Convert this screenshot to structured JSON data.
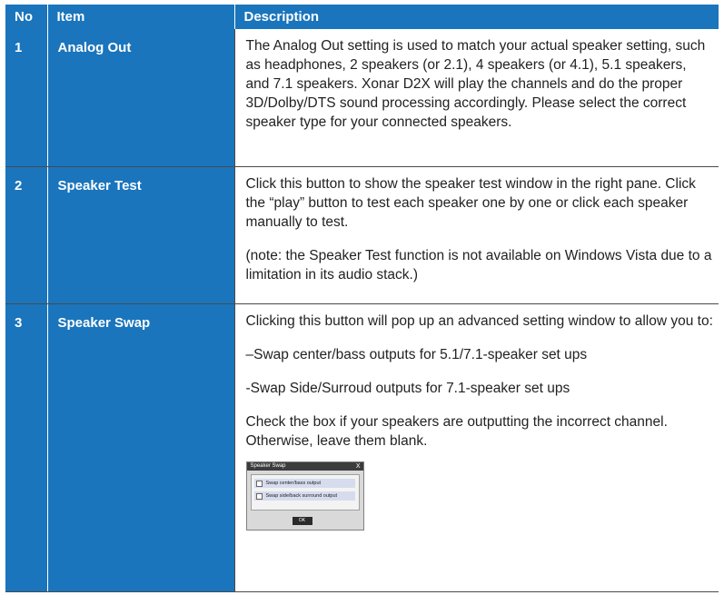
{
  "headers": {
    "no": "No",
    "item": "Item",
    "description": "Description"
  },
  "rows": [
    {
      "no": "1",
      "item": "Analog Out",
      "paragraphs": [
        "The Analog Out setting is used to match your actual speaker setting, such as headphones, 2 speakers (or 2.1), 4 speakers (or 4.1), 5.1 speakers, and 7.1 speakers. Xonar D2X will play the channels and do the proper 3D/Dolby/DTS sound processing accordingly. Please select the correct speaker type for your connected speakers."
      ]
    },
    {
      "no": "2",
      "item": "Speaker Test",
      "paragraphs": [
        "Click this button to show the speaker test window in the right pane. Click the “play” button to test each speaker one by one or click each speaker manually to test.",
        "(note: the Speaker Test function is not available on Windows Vista due to a limitation in its audio stack.)"
      ]
    },
    {
      "no": "3",
      "item": "Speaker Swap",
      "paragraphs": [
        "Clicking this button will pop up an advanced setting window to allow you to:",
        "–Swap center/bass outputs for 5.1/7.1-speaker set ups",
        "-Swap Side/Surroud outputs for 7.1-speaker set ups",
        "Check the box if your speakers are outputting the incorrect channel. Otherwise, leave them blank."
      ],
      "dialog": {
        "title": "Speaker Swap",
        "close": "X",
        "options": [
          "Swap center/bass output",
          "Swap side/back surround output"
        ],
        "ok": "OK"
      }
    }
  ]
}
